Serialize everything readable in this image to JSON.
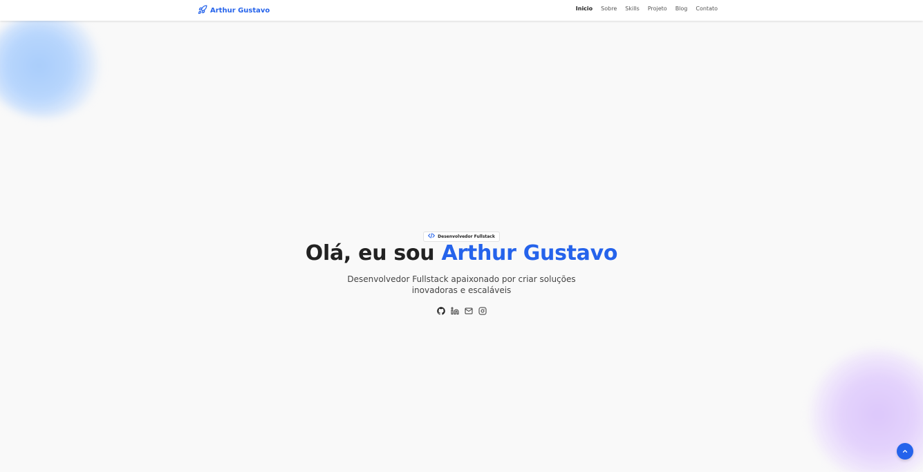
{
  "header": {
    "brand": "Arthur Gustavo",
    "nav": [
      "Inicio",
      "Sobre",
      "Skills",
      "Projeto",
      "Blog",
      "Contato"
    ],
    "active_nav": "Inicio"
  },
  "hero": {
    "badge": "Desenvolvedor Fullstack",
    "greeting": "Olá, eu sou ",
    "name": "Arthur Gustavo",
    "subtitle": "Desenvolvedor Fullstack apaixonado por criar soluções inovadoras e escaláveis",
    "socials": [
      "github-icon",
      "linkedin-icon",
      "mail-icon",
      "instagram-icon"
    ]
  },
  "colors": {
    "accent": "#2563eb",
    "background": "#f9f9f9"
  }
}
